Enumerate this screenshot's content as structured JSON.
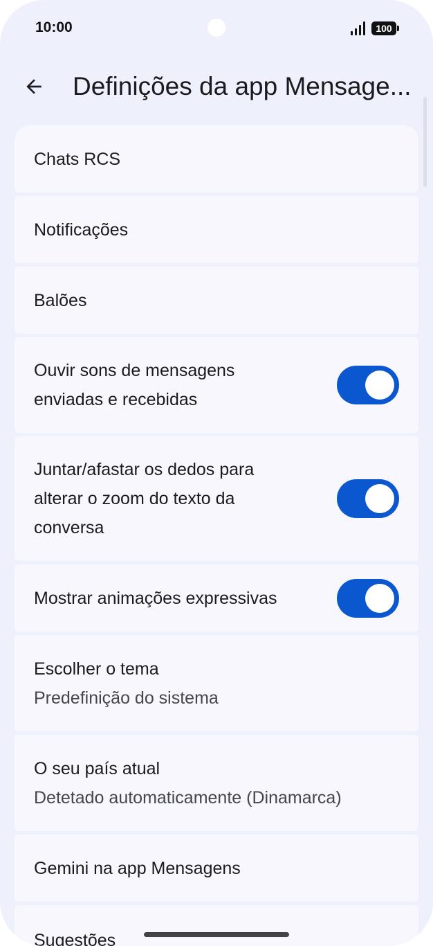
{
  "status_bar": {
    "time": "10:00",
    "battery": "100"
  },
  "header": {
    "title": "Definições da app Mensage..."
  },
  "settings": {
    "items": [
      {
        "title": "Chats RCS"
      },
      {
        "title": "Notificações"
      },
      {
        "title": "Balões"
      },
      {
        "title": "Ouvir sons de mensagens enviadas e recebidas",
        "toggle_on": true
      },
      {
        "title": "Juntar/afastar os dedos para alterar o zoom do texto da conversa",
        "toggle_on": true
      },
      {
        "title": "Mostrar animações expressivas",
        "toggle_on": true
      },
      {
        "title": "Escolher o tema",
        "subtitle": "Predefinição do sistema"
      },
      {
        "title": "O seu país atual",
        "subtitle": "Detetado automaticamente (Dinamarca)"
      },
      {
        "title": "Gemini na app Mensagens"
      },
      {
        "title": "Sugestões"
      }
    ]
  },
  "colors": {
    "background": "#eef0fb",
    "card": "#f7f7fd",
    "accent": "#0b57d0"
  }
}
